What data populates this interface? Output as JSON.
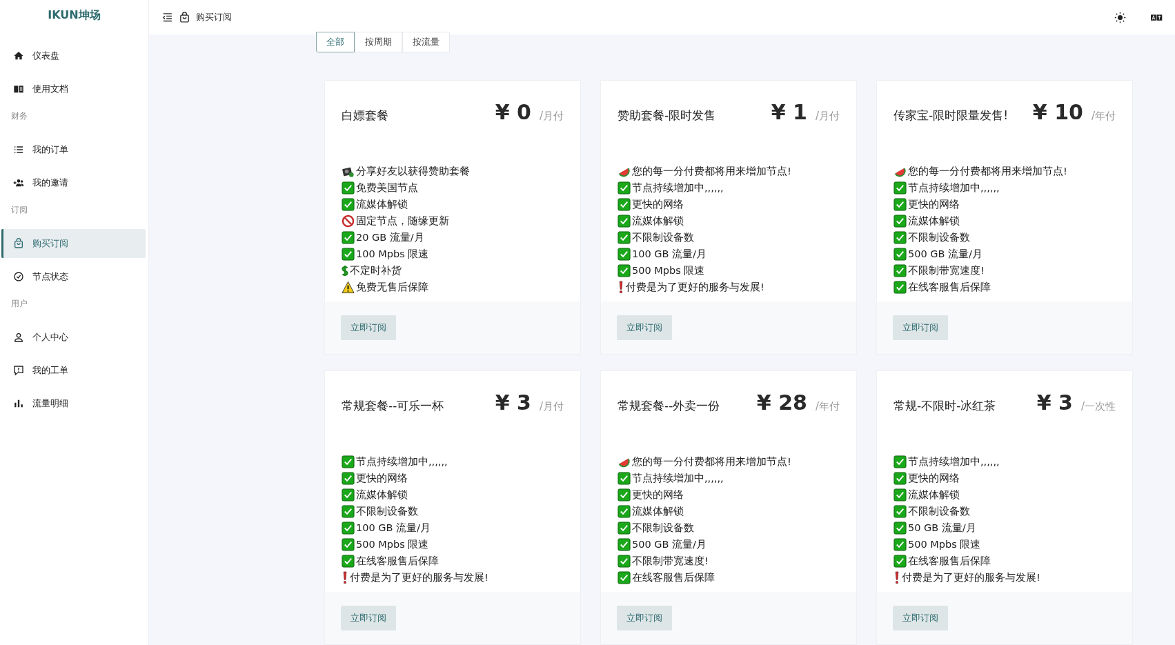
{
  "sidebar": {
    "logo": "IKUN坤场",
    "items": [
      {
        "kind": "link",
        "label": "仪表盘",
        "selected": false
      },
      {
        "kind": "link",
        "label": "使用文档",
        "selected": false
      },
      {
        "kind": "section",
        "label": "财务"
      },
      {
        "kind": "link",
        "label": "我的订单",
        "selected": false
      },
      {
        "kind": "link",
        "label": "我的邀请",
        "selected": false
      },
      {
        "kind": "section",
        "label": "订阅"
      },
      {
        "kind": "link",
        "label": "购买订阅",
        "selected": true
      },
      {
        "kind": "link",
        "label": "节点状态",
        "selected": false
      },
      {
        "kind": "section",
        "label": "用户"
      },
      {
        "kind": "link",
        "label": "个人中心",
        "selected": false
      },
      {
        "kind": "link",
        "label": "我的工单",
        "selected": false
      },
      {
        "kind": "link",
        "label": "流量明细",
        "selected": false
      }
    ]
  },
  "header": {
    "breadcrumb": "购买订阅"
  },
  "tabs": [
    {
      "label": "全部",
      "selected": true
    },
    {
      "label": "按周期",
      "selected": false
    },
    {
      "label": "按流量",
      "selected": false
    }
  ],
  "plans": [
    {
      "name": "白嫖套餐",
      "price": "¥ 0",
      "period": "/月付",
      "button": "立即订阅",
      "features": [
        {
          "kind": "camera",
          "text": "分享好友以获得赞助套餐"
        },
        {
          "kind": "check",
          "text": "免费美国节点"
        },
        {
          "kind": "check",
          "text": "流媒体解锁"
        },
        {
          "kind": "ban",
          "text": "固定节点，随缘更新"
        },
        {
          "kind": "check",
          "text": "20 GB 流量/月"
        },
        {
          "kind": "check",
          "text": "100 Mpbs 限速"
        },
        {
          "kind": "dollar",
          "text": "不定时补货"
        },
        {
          "kind": "warning",
          "text": "免费无售后保障"
        }
      ]
    },
    {
      "name": "赞助套餐-限时发售",
      "price": "¥ 1",
      "period": "/月付",
      "button": "立即订阅",
      "features": [
        {
          "kind": "melon",
          "text": "您的每一分付费都将用来增加节点!"
        },
        {
          "kind": "check",
          "text": "节点持续增加中,,,,,,"
        },
        {
          "kind": "check",
          "text": "更快的网络"
        },
        {
          "kind": "check",
          "text": "流媒体解锁"
        },
        {
          "kind": "check",
          "text": "不限制设备数"
        },
        {
          "kind": "check",
          "text": "100 GB 流量/月"
        },
        {
          "kind": "check",
          "text": "500 Mpbs 限速"
        },
        {
          "kind": "exclaim",
          "text": "付费是为了更好的服务与发展!"
        }
      ]
    },
    {
      "name": "传家宝-限时限量发售!",
      "price": "¥ 10",
      "period": "/年付",
      "button": "立即订阅",
      "features": [
        {
          "kind": "melon",
          "text": "您的每一分付费都将用来增加节点!"
        },
        {
          "kind": "check",
          "text": "节点持续增加中,,,,,,"
        },
        {
          "kind": "check",
          "text": "更快的网络"
        },
        {
          "kind": "check",
          "text": "流媒体解锁"
        },
        {
          "kind": "check",
          "text": "不限制设备数"
        },
        {
          "kind": "check",
          "text": "500 GB 流量/月"
        },
        {
          "kind": "check",
          "text": "不限制带宽速度!"
        },
        {
          "kind": "check",
          "text": "在线客服售后保障"
        }
      ]
    },
    {
      "name": "常规套餐--可乐一杯",
      "price": "¥ 3",
      "period": "/月付",
      "button": "立即订阅",
      "features": [
        {
          "kind": "check",
          "text": "节点持续增加中,,,,,,"
        },
        {
          "kind": "check",
          "text": "更快的网络"
        },
        {
          "kind": "check",
          "text": "流媒体解锁"
        },
        {
          "kind": "check",
          "text": "不限制设备数"
        },
        {
          "kind": "check",
          "text": "100 GB 流量/月"
        },
        {
          "kind": "check",
          "text": "500 Mpbs 限速"
        },
        {
          "kind": "check",
          "text": "在线客服售后保障"
        },
        {
          "kind": "exclaim",
          "text": "付费是为了更好的服务与发展!"
        }
      ]
    },
    {
      "name": "常规套餐--外卖一份",
      "price": "¥ 28",
      "period": "/年付",
      "button": "立即订阅",
      "features": [
        {
          "kind": "melon",
          "text": "您的每一分付费都将用来增加节点!"
        },
        {
          "kind": "check",
          "text": "节点持续增加中,,,,,,"
        },
        {
          "kind": "check",
          "text": "更快的网络"
        },
        {
          "kind": "check",
          "text": "流媒体解锁"
        },
        {
          "kind": "check",
          "text": "不限制设备数"
        },
        {
          "kind": "check",
          "text": "500 GB 流量/月"
        },
        {
          "kind": "check",
          "text": "不限制带宽速度!"
        },
        {
          "kind": "check",
          "text": "在线客服售后保障"
        }
      ]
    },
    {
      "name": "常规-不限时-冰红茶",
      "price": "¥ 3",
      "period": "/一次性",
      "button": "立即订阅",
      "features": [
        {
          "kind": "check",
          "text": "节点持续增加中,,,,,,"
        },
        {
          "kind": "check",
          "text": "更快的网络"
        },
        {
          "kind": "check",
          "text": "流媒体解锁"
        },
        {
          "kind": "check",
          "text": "不限制设备数"
        },
        {
          "kind": "check",
          "text": "50 GB 流量/月"
        },
        {
          "kind": "check",
          "text": "500 Mpbs 限速"
        },
        {
          "kind": "check",
          "text": "在线客服售后保障"
        },
        {
          "kind": "exclaim",
          "text": "付费是为了更好的服务与发展!"
        }
      ]
    }
  ]
}
